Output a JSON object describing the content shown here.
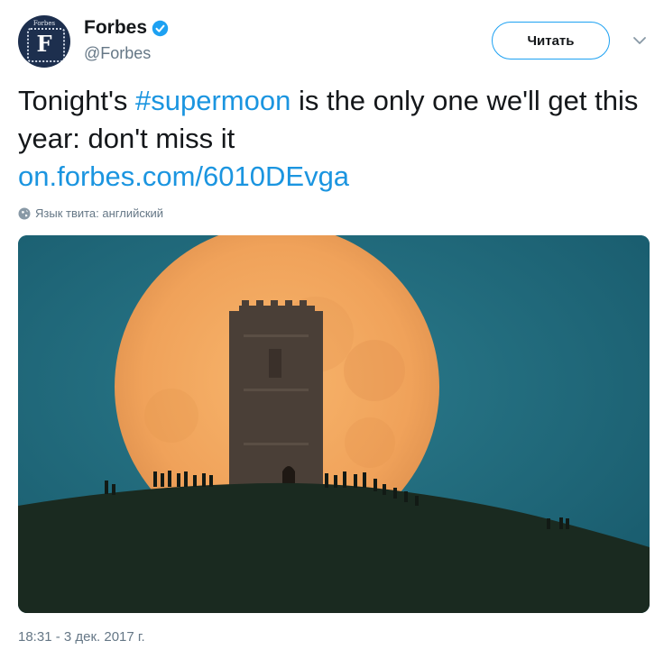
{
  "author": {
    "name": "Forbes",
    "handle": "@Forbes",
    "verified": true,
    "avatar_word": "Forbes",
    "avatar_letter": "F"
  },
  "follow_button": {
    "label": "Читать"
  },
  "tweet": {
    "text_before": "Tonight's ",
    "hashtag": "#supermoon",
    "text_after": " is the only one we'll get this year: don't miss it",
    "link": "on.forbes.com/6010DEvga"
  },
  "language_note": "Язык твита: английский",
  "timestamp": "18:31 - 3 дек. 2017 г.",
  "icons": {
    "verified": "verified-badge-icon",
    "menu": "chevron-down-icon",
    "language": "globe-icon"
  },
  "colors": {
    "accent": "#1da1f2",
    "link": "#1b95e0",
    "secondary_text": "#657786",
    "photo_sky": "#1d6376",
    "photo_moon": "#f2a55a"
  }
}
